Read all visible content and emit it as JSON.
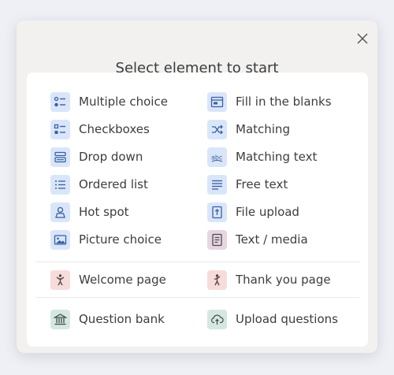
{
  "dialog": {
    "title": "Select element to start"
  },
  "elements": [
    {
      "label": "Multiple choice",
      "icon": "multiple-choice-icon"
    },
    {
      "label": "Fill in the blanks",
      "icon": "fill-blanks-icon"
    },
    {
      "label": "Checkboxes",
      "icon": "checkboxes-icon"
    },
    {
      "label": "Matching",
      "icon": "shuffle-icon"
    },
    {
      "label": "Drop down",
      "icon": "dropdown-icon"
    },
    {
      "label": "Matching text",
      "icon": "matching-text-icon"
    },
    {
      "label": "Ordered list",
      "icon": "ordered-list-icon"
    },
    {
      "label": "Free text",
      "icon": "free-text-icon"
    },
    {
      "label": "Hot spot",
      "icon": "hot-spot-icon"
    },
    {
      "label": "File upload",
      "icon": "file-upload-icon"
    },
    {
      "label": "Picture choice",
      "icon": "picture-icon"
    },
    {
      "label": "Text / media",
      "icon": "text-media-icon"
    }
  ],
  "pages": [
    {
      "label": "Welcome page",
      "icon": "welcome-person-icon"
    },
    {
      "label": "Thank you page",
      "icon": "thank-you-person-icon"
    }
  ],
  "bank": [
    {
      "label": "Question bank",
      "icon": "bank-icon"
    },
    {
      "label": "Upload questions",
      "icon": "cloud-upload-icon"
    }
  ],
  "colors": {
    "blue_tile": "#d9e6fa",
    "purple_tile": "#e7d6e0",
    "pink_tile": "#f7dcdc",
    "green_tile": "#d5e7e1",
    "icon_blue": "#3a5fa0"
  }
}
